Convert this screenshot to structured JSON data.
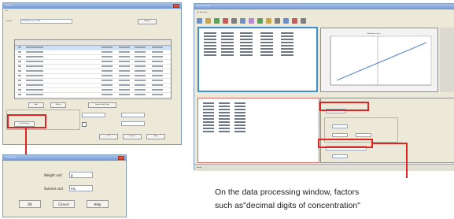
{
  "left_window": {
    "title": "Sample",
    "sample_name_label": "Sample",
    "sample_name_value": "ICP Measurement 2008",
    "browse_label": "Browse",
    "table_headers": [
      "No",
      "Name",
      "Weight",
      "Volume",
      "Dilute",
      "Concentration"
    ],
    "table_rows": 11,
    "buttons": [
      "Add",
      "Delete",
      "Import Label Data"
    ],
    "status_label": "Unit Settings",
    "ok_label": "OK",
    "cancel_label": "Cancel",
    "help_label": "Help"
  },
  "dialog": {
    "title": "Unit Setting",
    "weight_label": "Weight unit",
    "weight_value": "g",
    "volume_label": "Solvent unit",
    "volume_value": "mL",
    "ok_label": "OK",
    "cancel_label": "Cancel",
    "help_label": "Help"
  },
  "right_window": {
    "title": "Data Processing",
    "chart_title": "Calibration Curve",
    "status_text": "Ready"
  },
  "caption": {
    "line1": "On the data processing window, factors",
    "line2": "such as\"decimal digits of concentration\""
  },
  "colors": {
    "highlight": "#e02323",
    "window_bg": "#ece9d8",
    "title_bar": "#6f95d3",
    "plot_line": "#5b86c9"
  }
}
